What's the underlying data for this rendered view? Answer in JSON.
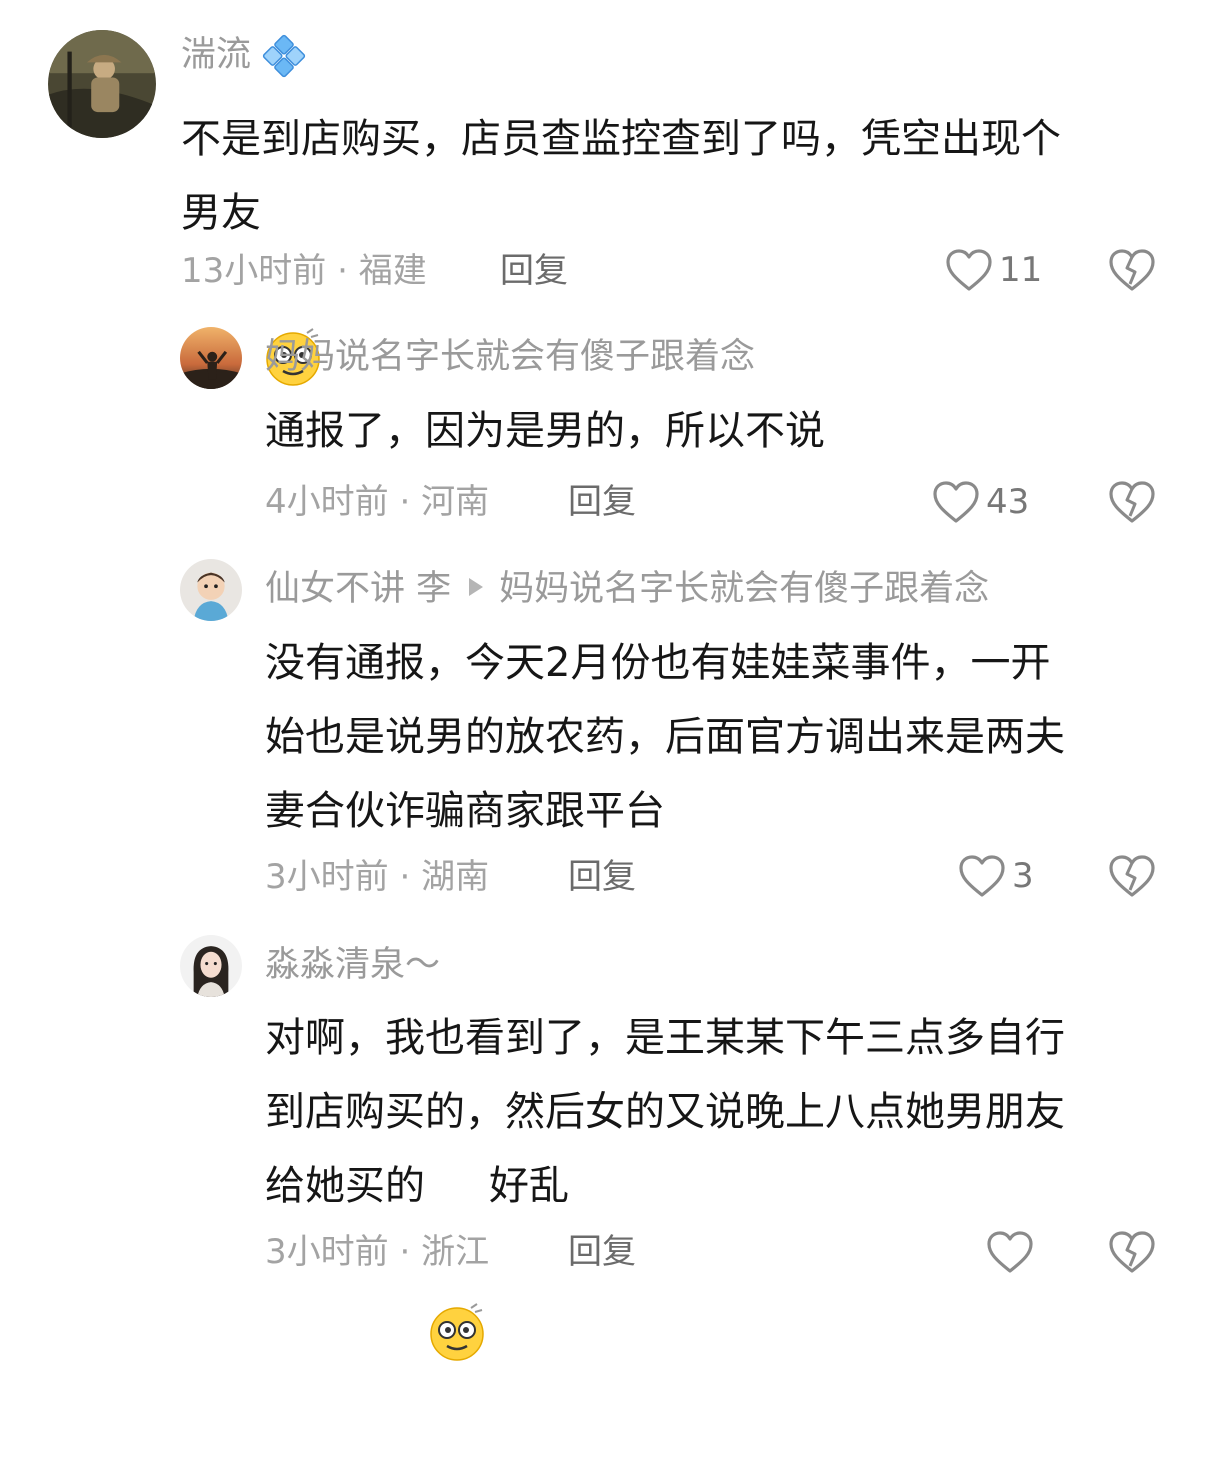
{
  "comments": [
    {
      "username": "湍流",
      "text_1": "不是到店购买，店员查监控查到了吗，凭空出现个",
      "text_2": "男友",
      "emoji": "dizzy-face-emoji",
      "time": "13小时前",
      "location": "福建",
      "reply_label": "回复",
      "likes": "11"
    },
    {
      "username": "妈妈说名字长就会有傻子跟着念",
      "text": "通报了，因为是男的，所以不说",
      "time": "4小时前",
      "location": "河南",
      "reply_label": "回复",
      "likes": "43"
    },
    {
      "username": "仙女不讲 李",
      "reply_to": "妈妈说名字长就会有傻子跟着念",
      "text_lines": [
        "没有通报，今天2月份也有娃娃菜事件，一开",
        "始也是说男的放农药，后面官方调出来是两夫",
        "妻合伙诈骗商家跟平台"
      ],
      "time": "3小时前",
      "location": "湖南",
      "reply_label": "回复",
      "likes": "3"
    },
    {
      "username": "淼淼清泉～",
      "text_lines": [
        "对啊，我也看到了，是王某某下午三点多自行",
        "到店购买的，然后女的又说晚上八点她男朋友"
      ],
      "text_last_a": "给她买的",
      "emoji": "dizzy-face-emoji",
      "text_last_b": "好乱",
      "time": "3小时前",
      "location": "浙江",
      "reply_label": "回复",
      "likes": ""
    }
  ],
  "separator": " · ",
  "colors": {
    "text": "#161616",
    "muted": "#a3a3a3",
    "username": "#9a9a9a",
    "reply": "#6b6b6b",
    "badge": "#5fa9f0"
  }
}
